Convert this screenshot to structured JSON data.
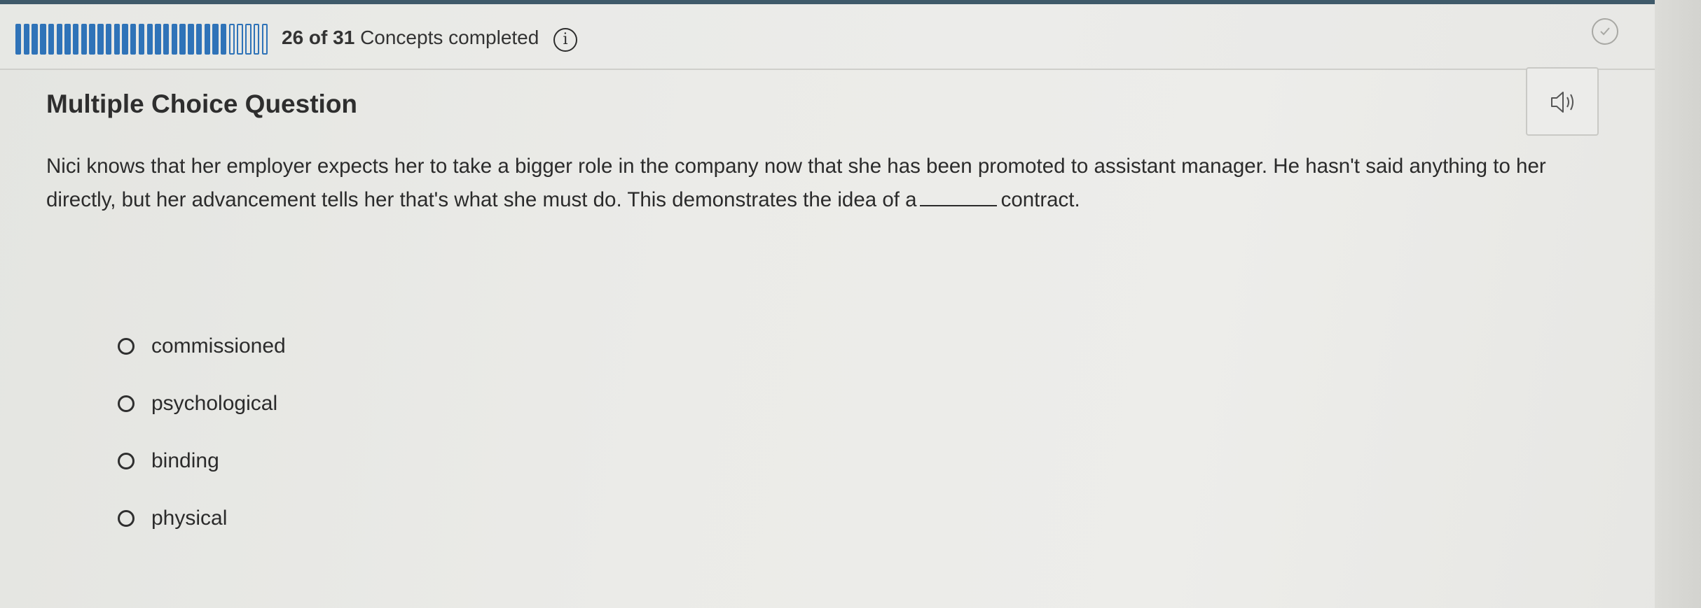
{
  "progress": {
    "completed": 26,
    "total": 31,
    "count_text": "26 of 31",
    "suffix_text": "Concepts completed"
  },
  "icons": {
    "info": "info-icon",
    "check": "check-circle-icon",
    "audio": "speaker-icon"
  },
  "question": {
    "type_label": "Multiple Choice Question",
    "text_before_blank": "Nici knows that her employer expects her to take a bigger role in the company now that she has been promoted to assistant manager. He hasn't said anything to her directly, but her advancement tells her that's what she must do. This demonstrates the idea of a",
    "text_after_blank": "contract."
  },
  "options": [
    {
      "label": "commissioned"
    },
    {
      "label": "psychological"
    },
    {
      "label": "binding"
    },
    {
      "label": "physical"
    }
  ],
  "colors": {
    "accent": "#2f73b8",
    "text": "#2b2b2b",
    "header_border": "#cfcfcb"
  }
}
